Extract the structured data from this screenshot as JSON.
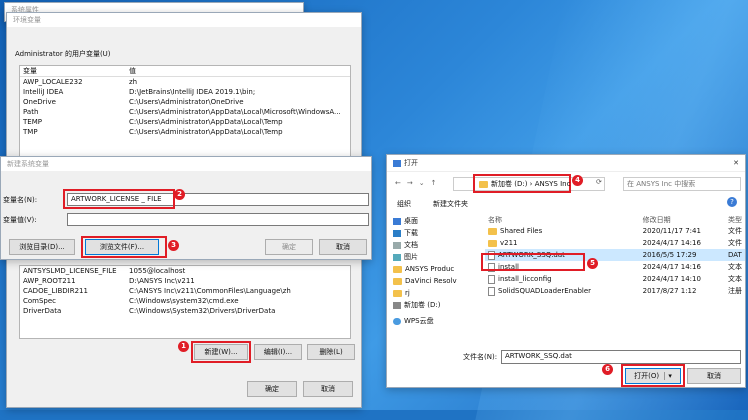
{
  "env_window": {
    "title": "环境变量",
    "partial_title": "系统属性",
    "user_vars_label": "Administrator 的用户变量(U)",
    "columns": [
      "变量",
      "值"
    ],
    "user_rows": [
      [
        "AWP_LOCALE232",
        "zh"
      ],
      [
        "IntelliJ IDEA",
        "D:\\JetBrains\\IntelliJ IDEA 2019.1\\bin;"
      ],
      [
        "OneDrive",
        "C:\\Users\\Administrator\\OneDrive"
      ],
      [
        "Path",
        "C:\\Users\\Administrator\\AppData\\Local\\Microsoft\\WindowsA..."
      ],
      [
        "TEMP",
        "C:\\Users\\Administrator\\AppData\\Local\\Temp"
      ],
      [
        "TMP",
        "C:\\Users\\Administrator\\AppData\\Local\\Temp"
      ]
    ],
    "system_rows": [
      [
        "ANTSYSLMD_LICENSE_FILE",
        "1055@localhost"
      ],
      [
        "AWP_ROOT211",
        "D:\\ANSYS Inc\\v211"
      ],
      [
        "CADOE_LIBDIR211",
        "C:\\ANSYS Inc\\v211\\CommonFiles\\Language\\zh"
      ],
      [
        "ComSpec",
        "C:\\Windows\\system32\\cmd.exe"
      ],
      [
        "DriverData",
        "C:\\Windows\\System32\\Drivers\\DriverData"
      ]
    ],
    "new_btn": "新建(W)...",
    "edit_btn": "编辑(I)...",
    "delete_btn": "删除(L)",
    "ok_btn": "确定",
    "cancel_btn": "取消"
  },
  "new_var_dialog": {
    "title": "新建系统变量",
    "name_label": "变量名(N):",
    "value_label": "变量值(V):",
    "name_value": "ARTWORK_LICENSE _ FILE",
    "value_value": "",
    "browse_dir": "浏览目录(D)...",
    "browse_file": "浏览文件(F)...",
    "ok": "确定",
    "cancel": "取消"
  },
  "open_dialog": {
    "title": "打开",
    "breadcrumb": [
      "新加卷 (D:)",
      "ANSYS Inc"
    ],
    "search_placeholder": "在 ANSYS Inc 中搜索",
    "organize": "组织",
    "new_folder": "新建文件夹",
    "nav": [
      "桌面",
      "下载",
      "文档",
      "图片",
      "ANSYS Produc",
      "DaVinci Resolv",
      "rj",
      "新加卷 (D:)",
      "WPS云盘"
    ],
    "headers": [
      "名称",
      "修改日期",
      "类型"
    ],
    "files": [
      {
        "name": "Shared Files",
        "date": "2020/11/17 7:41",
        "type": "文件",
        "kind": "folder"
      },
      {
        "name": "v211",
        "date": "2024/4/17 14:16",
        "type": "文件",
        "kind": "folder"
      },
      {
        "name": "ARTWORK_SSQ.dat",
        "date": "2016/5/5 17:29",
        "type": "DAT",
        "kind": "file"
      },
      {
        "name": "install",
        "date": "2024/4/17 14:16",
        "type": "文本",
        "kind": "file"
      },
      {
        "name": "install_licconfig",
        "date": "2024/4/17 14:10",
        "type": "文本",
        "kind": "file"
      },
      {
        "name": "SolidSQUADLoaderEnabler",
        "date": "2017/8/27 1:12",
        "type": "注册",
        "kind": "file"
      }
    ],
    "filename_label": "文件名(N):",
    "filename_value": "ARTWORK_SSQ.dat",
    "open_btn": "打开(O)",
    "cancel_btn": "取消"
  },
  "badges": [
    "1",
    "2",
    "3",
    "4",
    "5",
    "6"
  ],
  "accent": "#e01d26"
}
